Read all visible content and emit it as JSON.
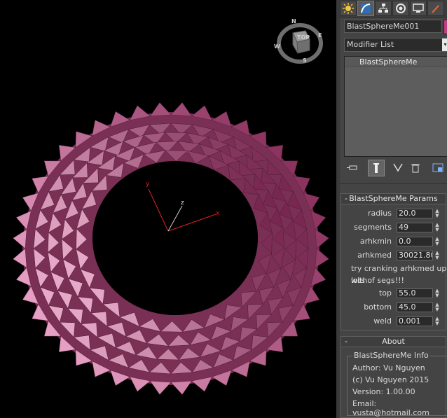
{
  "viewport": {
    "viewcube": {
      "n": "N",
      "e": "E",
      "s": "S",
      "w": "W",
      "top": "TOP"
    },
    "axes": {
      "x": "x",
      "y": "y",
      "z": "z"
    },
    "colors": {
      "mesh": "#b0507e",
      "mesh_light": "#e3a6c4",
      "axis": "#e02020"
    }
  },
  "panel": {
    "tabs": [
      "create-tab",
      "modify-tab",
      "hierarchy-tab",
      "motion-tab",
      "display-tab",
      "utilities-tab"
    ],
    "object_name": "BlastSphereMe001",
    "object_color": "#c0407f",
    "modifier_list": "Modifier List",
    "stack_items": [
      "BlastSphereMe"
    ]
  },
  "params": {
    "title": "BlastSphereMe Params",
    "minus": "-",
    "radius_label": "radius",
    "radius": "20.0",
    "segments_label": "segments",
    "segments": "49",
    "arhkmin_label": "arhkmin",
    "arhkmin": "0.0",
    "arhkmed_label": "arhkmed",
    "arhkmed": "30021.800",
    "note_line1": "try cranking arhkmed up with",
    "note_line2": "lots of segs!!!",
    "top_label": "top",
    "top": "55.0",
    "bottom_label": "bottom",
    "bottom": "45.0",
    "weld_label": "weld",
    "weld": "0.001"
  },
  "about": {
    "title": "About",
    "minus": "-",
    "group_title": "BlastSphereMe Info",
    "author": "Author: Vu Nguyen",
    "copyright": "(c) Vu Nguyen 2015",
    "version": "Version: 1.00.00",
    "email": "Email: vusta@hotmail.com"
  }
}
